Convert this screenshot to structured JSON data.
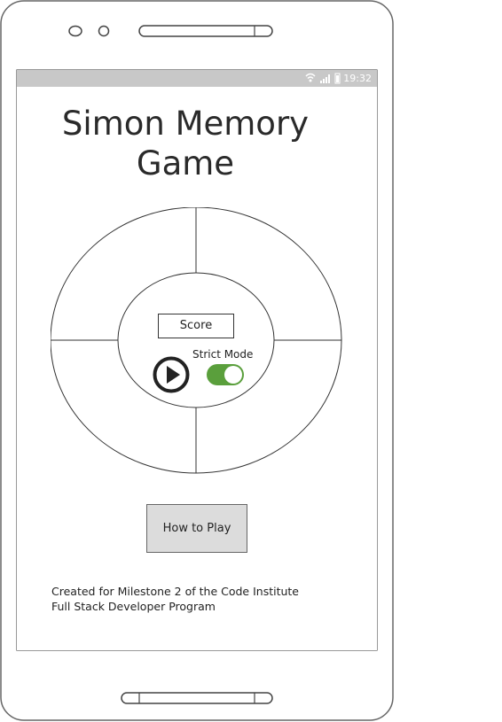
{
  "status_bar": {
    "time": "19:32",
    "icons": [
      "wifi-icon",
      "signal-icon",
      "battery-icon"
    ]
  },
  "title": {
    "line1": "Simon Memory",
    "line2": "Game"
  },
  "game": {
    "score_label": "Score",
    "strict_mode_label": "Strict Mode",
    "strict_mode_on": true,
    "play_icon": "play-icon"
  },
  "how_to_play_label": "How to Play",
  "footer": {
    "line1": "Created for Milestone 2 of the Code Institute",
    "line2": "Full Stack Developer Program"
  },
  "colors": {
    "toggle_on": "#5a9f3c",
    "status_bar": "#c8c8c8",
    "button_bg": "#dcdcdc"
  }
}
